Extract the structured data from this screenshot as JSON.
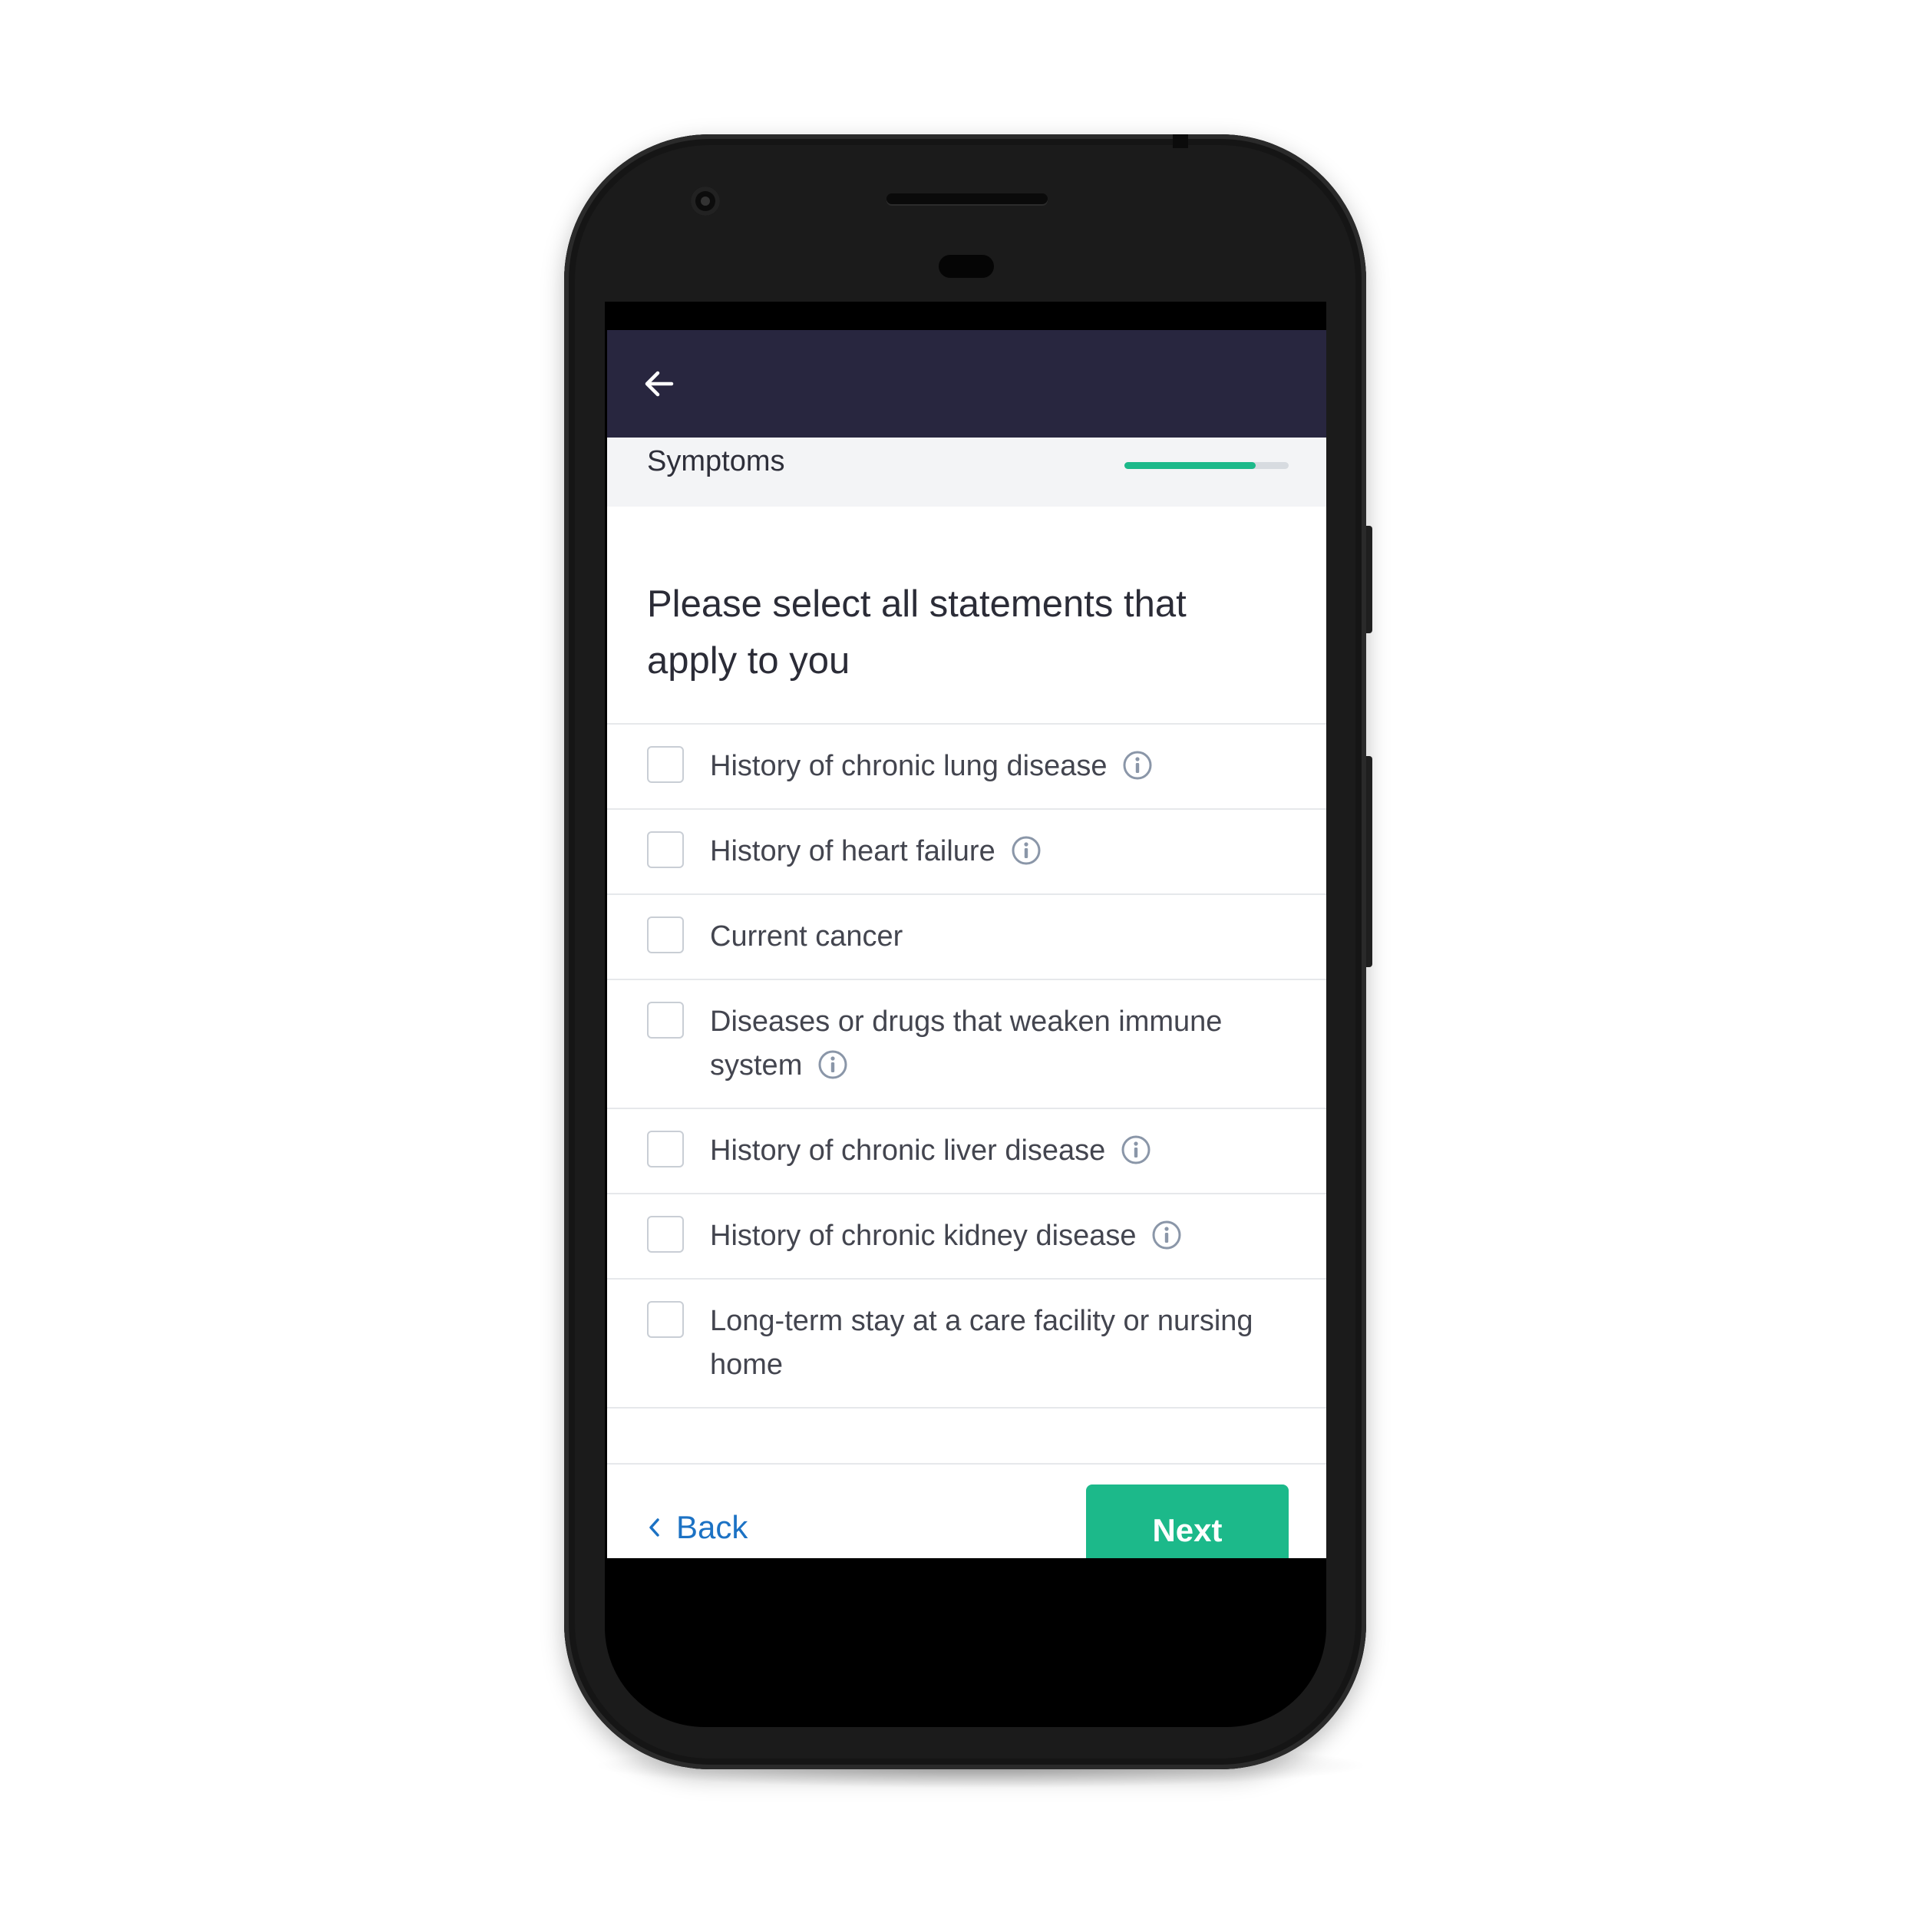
{
  "header": {
    "back_icon": "arrow-left-icon",
    "background_color": "#28263f"
  },
  "section": {
    "title": "Symptoms",
    "progress": 0.8,
    "progress_color": "#1cb98a"
  },
  "question": {
    "text": "Please select all statements that apply to you"
  },
  "options": [
    {
      "label": "History of chronic lung disease",
      "has_info": true,
      "checked": false
    },
    {
      "label": "History of heart failure",
      "has_info": true,
      "checked": false
    },
    {
      "label": "Current cancer",
      "has_info": false,
      "checked": false
    },
    {
      "label": "Diseases or drugs that weaken immune system",
      "has_info": true,
      "checked": false
    },
    {
      "label": "History of chronic liver disease",
      "has_info": true,
      "checked": false
    },
    {
      "label": "History of chronic kidney disease",
      "has_info": true,
      "checked": false
    },
    {
      "label": "Long-term stay at a care facility or nursing home",
      "has_info": false,
      "checked": false
    }
  ],
  "footer": {
    "back_label": "Back",
    "next_label": "Next",
    "link_color": "#1c72c4",
    "next_color": "#1cb98a"
  }
}
